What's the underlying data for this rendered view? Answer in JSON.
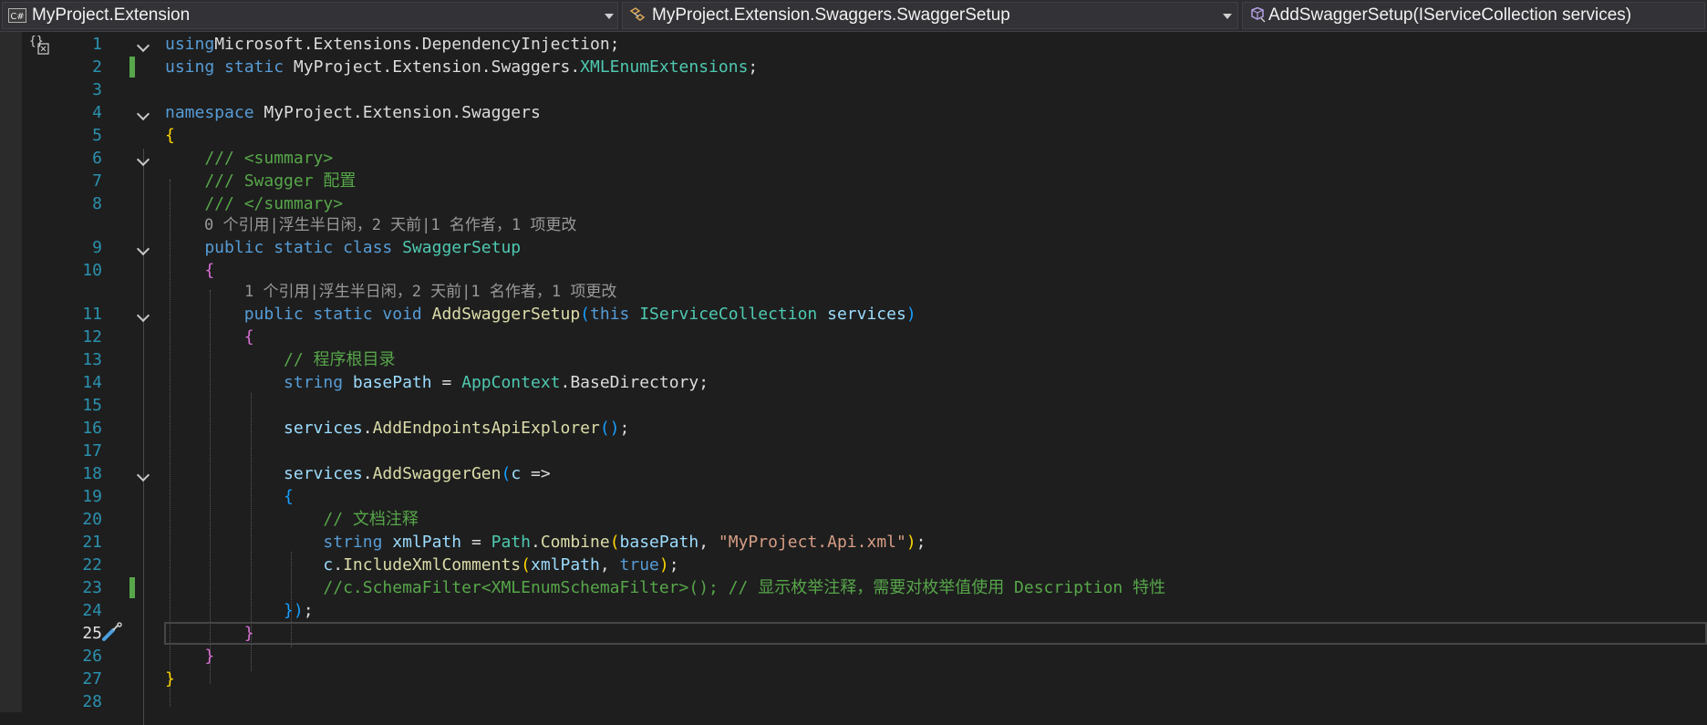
{
  "navbar": {
    "project": "MyProject.Extension",
    "type": "MyProject.Extension.Swaggers.SwaggerSetup",
    "member": "AddSwaggerSetup(IServiceCollection services)",
    "project_icon": "csharp-project-icon",
    "type_icon": "class-icon",
    "member_icon": "method-icon"
  },
  "colors": {
    "keyword": "#569cd6",
    "type": "#4ec9b0",
    "method": "#dcdcaa",
    "string": "#d69d85",
    "comment": "#57a64a",
    "line_number": "#2b91af",
    "change_bar": "#57a64a"
  },
  "code_lines": [
    {
      "n": "1",
      "tokens": [
        [
          "kw",
          "using"
        ],
        [
          "",
          "Microsoft.Extensions.DependencyInjection;"
        ]
      ]
    },
    {
      "n": "2",
      "tokens": [
        [
          "kw",
          "using"
        ],
        [
          "kw",
          " static "
        ],
        [
          "",
          "MyProject.Extension.Swaggers."
        ],
        [
          "ty",
          "XMLEnumExtensions"
        ],
        [
          "",
          ";"
        ]
      ]
    },
    {
      "n": "3",
      "tokens": []
    },
    {
      "n": "4",
      "tokens": [
        [
          "kw",
          "namespace"
        ],
        [
          "",
          " MyProject.Extension.Swaggers"
        ]
      ]
    },
    {
      "n": "5",
      "tokens": [
        [
          "br1",
          "{"
        ]
      ]
    },
    {
      "n": "6",
      "tokens": [
        [
          "cm",
          "    /// <summary>"
        ]
      ]
    },
    {
      "n": "7",
      "tokens": [
        [
          "cm",
          "    /// Swagger 配置"
        ]
      ]
    },
    {
      "n": "8",
      "tokens": [
        [
          "cm",
          "    /// </summary>"
        ]
      ]
    },
    {
      "lens": "0 个引用|浮生半日闲，2 天前|1 名作者，1 项更改"
    },
    {
      "n": "9",
      "tokens": [
        [
          "kw",
          "    public static class "
        ],
        [
          "ty",
          "SwaggerSetup"
        ]
      ]
    },
    {
      "n": "10",
      "tokens": [
        [
          "br2",
          "    {"
        ]
      ]
    },
    {
      "lens": "1 个引用|浮生半日闲，2 天前|1 名作者，1 项更改"
    },
    {
      "n": "11",
      "tokens": [
        [
          "kw",
          "        public static void "
        ],
        [
          "fn",
          "AddSwaggerSetup"
        ],
        [
          "br3",
          "("
        ],
        [
          "kw",
          "this "
        ],
        [
          "ty",
          "IServiceCollection"
        ],
        [
          "pm",
          " services"
        ],
        [
          "br3",
          ")"
        ]
      ]
    },
    {
      "n": "12",
      "tokens": [
        [
          "br2",
          "        {"
        ]
      ]
    },
    {
      "n": "13",
      "tokens": [
        [
          "cm",
          "            // 程序根目录"
        ]
      ]
    },
    {
      "n": "14",
      "tokens": [
        [
          "kw",
          "            string "
        ],
        [
          "pm",
          "basePath"
        ],
        [
          "",
          " = "
        ],
        [
          "ty",
          "AppContext"
        ],
        [
          "",
          ".BaseDirectory;"
        ]
      ]
    },
    {
      "n": "15",
      "tokens": []
    },
    {
      "n": "16",
      "tokens": [
        [
          "pm",
          "            services"
        ],
        [
          "",
          "."
        ],
        [
          "fn",
          "AddEndpointsApiExplorer"
        ],
        [
          "br3",
          "()"
        ],
        [
          "",
          ";"
        ]
      ]
    },
    {
      "n": "17",
      "tokens": []
    },
    {
      "n": "18",
      "tokens": [
        [
          "pm",
          "            services"
        ],
        [
          "",
          "."
        ],
        [
          "fn",
          "AddSwaggerGen"
        ],
        [
          "br3",
          "("
        ],
        [
          "pm",
          "c"
        ],
        [
          "",
          " =>"
        ]
      ]
    },
    {
      "n": "19",
      "tokens": [
        [
          "br3",
          "            {"
        ]
      ]
    },
    {
      "n": "20",
      "tokens": [
        [
          "cm",
          "                // 文档注释"
        ]
      ]
    },
    {
      "n": "21",
      "tokens": [
        [
          "kw",
          "                string "
        ],
        [
          "pm",
          "xmlPath"
        ],
        [
          "",
          " = "
        ],
        [
          "ty",
          "Path"
        ],
        [
          "",
          "."
        ],
        [
          "fn",
          "Combine"
        ],
        [
          "br1",
          "("
        ],
        [
          "pm",
          "basePath"
        ],
        [
          "",
          ", "
        ],
        [
          "st",
          "\"MyProject.Api.xml\""
        ],
        [
          "br1",
          ")"
        ],
        [
          "",
          ";"
        ]
      ]
    },
    {
      "n": "22",
      "tokens": [
        [
          "pm",
          "                c"
        ],
        [
          "",
          "."
        ],
        [
          "fn",
          "IncludeXmlComments"
        ],
        [
          "br1",
          "("
        ],
        [
          "pm",
          "xmlPath"
        ],
        [
          "",
          ", "
        ],
        [
          "kw",
          "true"
        ],
        [
          "br1",
          ")"
        ],
        [
          "",
          ";"
        ]
      ]
    },
    {
      "n": "23",
      "tokens": [
        [
          "cm",
          "                //c.SchemaFilter<XMLEnumSchemaFilter>(); // 显示枚举注释，需要对枚举值使用 Description 特性"
        ]
      ]
    },
    {
      "n": "24",
      "tokens": [
        [
          "br3",
          "            }"
        ],
        [
          "br3",
          ")"
        ],
        [
          "",
          ";"
        ]
      ]
    },
    {
      "n": "25",
      "tokens": [
        [
          "br2",
          "        }"
        ]
      ]
    },
    {
      "n": "26",
      "tokens": [
        [
          "br2",
          "    }"
        ]
      ]
    },
    {
      "n": "27",
      "tokens": [
        [
          "br1",
          "}"
        ]
      ]
    },
    {
      "n": "28",
      "tokens": []
    }
  ]
}
